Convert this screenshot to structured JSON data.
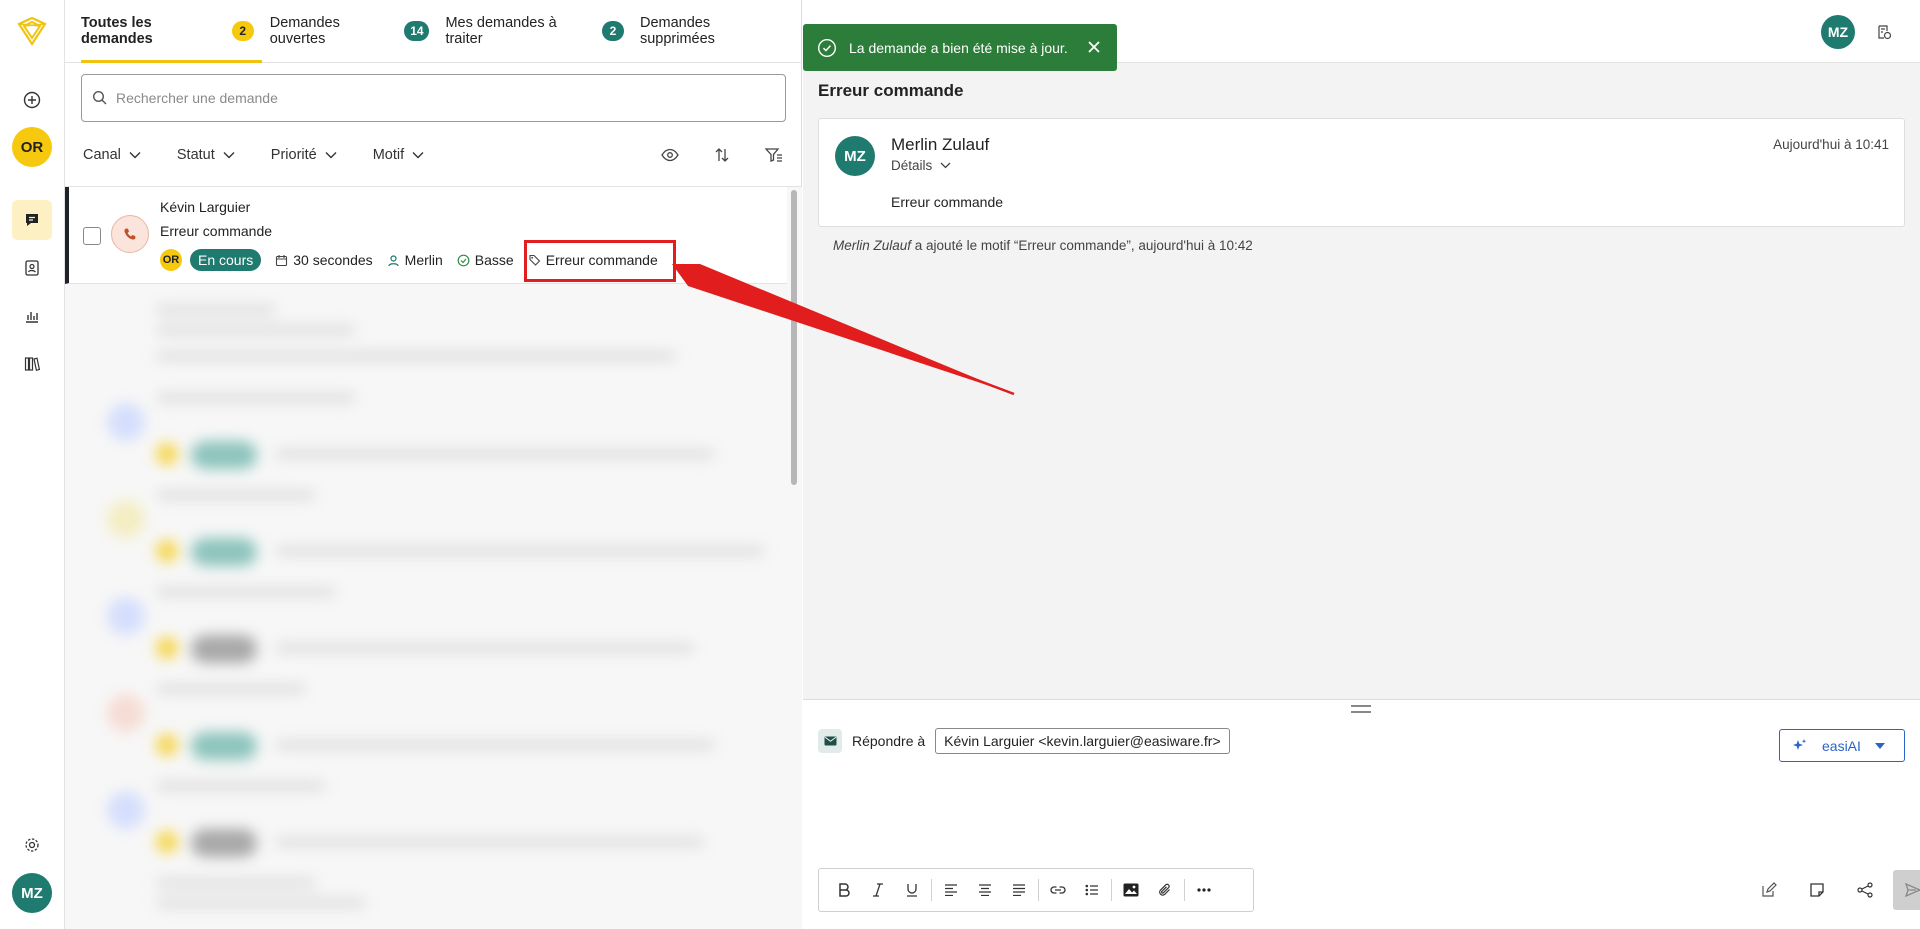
{
  "tabs": [
    {
      "label": "Toutes les demandes",
      "count": "2"
    },
    {
      "label": "Demandes ouvertes",
      "count": "14"
    },
    {
      "label": "Mes demandes à traiter",
      "count": "2"
    },
    {
      "label": "Demandes supprimées"
    }
  ],
  "rail": {
    "org_initials": "OR",
    "user_initials": "MZ"
  },
  "search": {
    "placeholder": "Rechercher une demande"
  },
  "filters": [
    "Canal",
    "Statut",
    "Priorité",
    "Motif"
  ],
  "request": {
    "name": "Kévin Larguier",
    "subject": "Erreur commande",
    "org": "OR",
    "status": "En cours",
    "duration": "30 secondes",
    "assignee": "Merlin",
    "priority": "Basse",
    "motif": "Erreur commande"
  },
  "toast": {
    "message": "La demande a bien été mise à jour."
  },
  "topbar": {
    "user_initials": "MZ"
  },
  "ticket": {
    "title": "Erreur commande",
    "message": {
      "author_initials": "MZ",
      "author": "Merlin Zulauf",
      "details_label": "Détails",
      "time": "Aujourd'hui à 10:41",
      "body": "Erreur commande"
    },
    "activity": {
      "actor": "Merlin Zulauf",
      "text": " a ajouté le motif “Erreur commande”, aujourd'hui à 10:42"
    }
  },
  "composer": {
    "reply_label": "Répondre à",
    "recipient": "Kévin Larguier <kevin.larguier@easiware.fr>",
    "ai_label": "easiAI"
  },
  "colors": {
    "accent_yellow": "#f6c90e",
    "teal": "#1f7a70",
    "toast_green": "#2d7d3a",
    "annotation_red": "#e11d1d"
  }
}
